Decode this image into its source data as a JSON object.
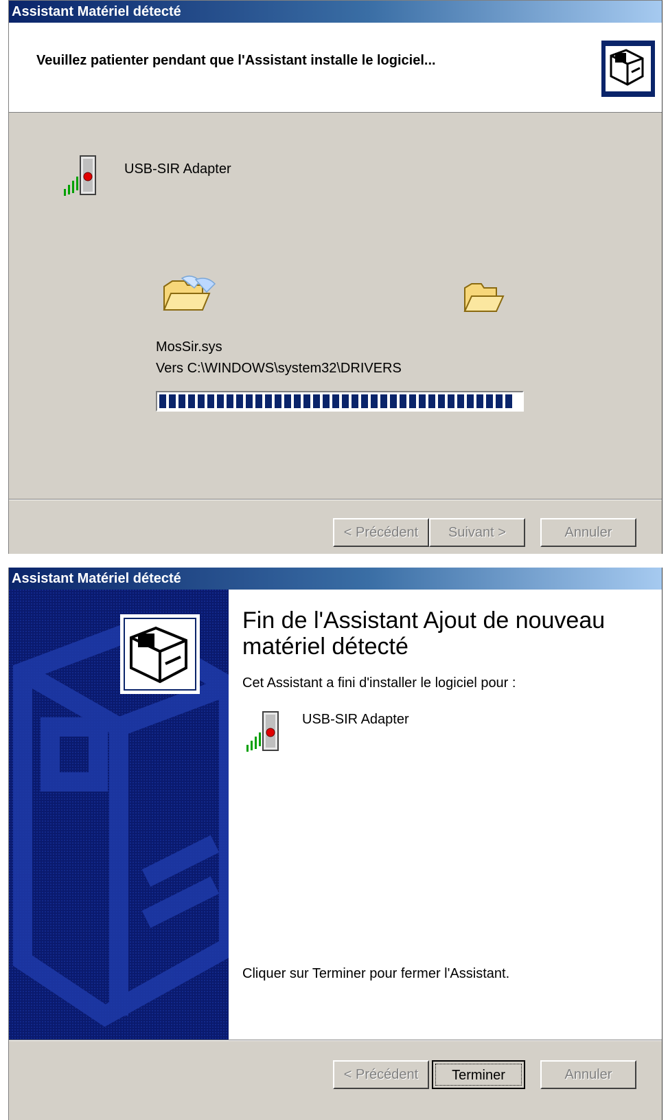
{
  "window1": {
    "title": "Assistant Matériel détecté",
    "header_title": "Veuillez patienter pendant que l'Assistant installe le logiciel...",
    "device_name": "USB-SIR Adapter",
    "file_name": "MosSir.sys",
    "file_destination": "Vers C:\\WINDOWS\\system32\\DRIVERS",
    "progress_fraction": 1.0,
    "buttons": {
      "back": "< Précédent",
      "next": "Suivant >",
      "cancel": "Annuler"
    }
  },
  "window2": {
    "title": "Assistant Matériel détecté",
    "heading": "Fin de l'Assistant Ajout de nouveau matériel détecté",
    "subtitle": "Cet Assistant a fini d'installer le logiciel pour :",
    "device_name": "USB-SIR Adapter",
    "finish_instruction": "Cliquer sur Terminer pour fermer l'Assistant.",
    "buttons": {
      "back": "< Précédent",
      "finish": "Terminer",
      "cancel": "Annuler"
    }
  },
  "colors": {
    "titlebar_start": "#0a246a",
    "titlebar_end": "#a6caf0",
    "dialog_face": "#d4d0c8",
    "progress_block": "#0a246a",
    "side_panel": "#0a1a6e"
  },
  "icons": [
    "wizard-hardware-icon",
    "infrared-device-icon",
    "folder-source-icon",
    "folder-destination-icon"
  ]
}
